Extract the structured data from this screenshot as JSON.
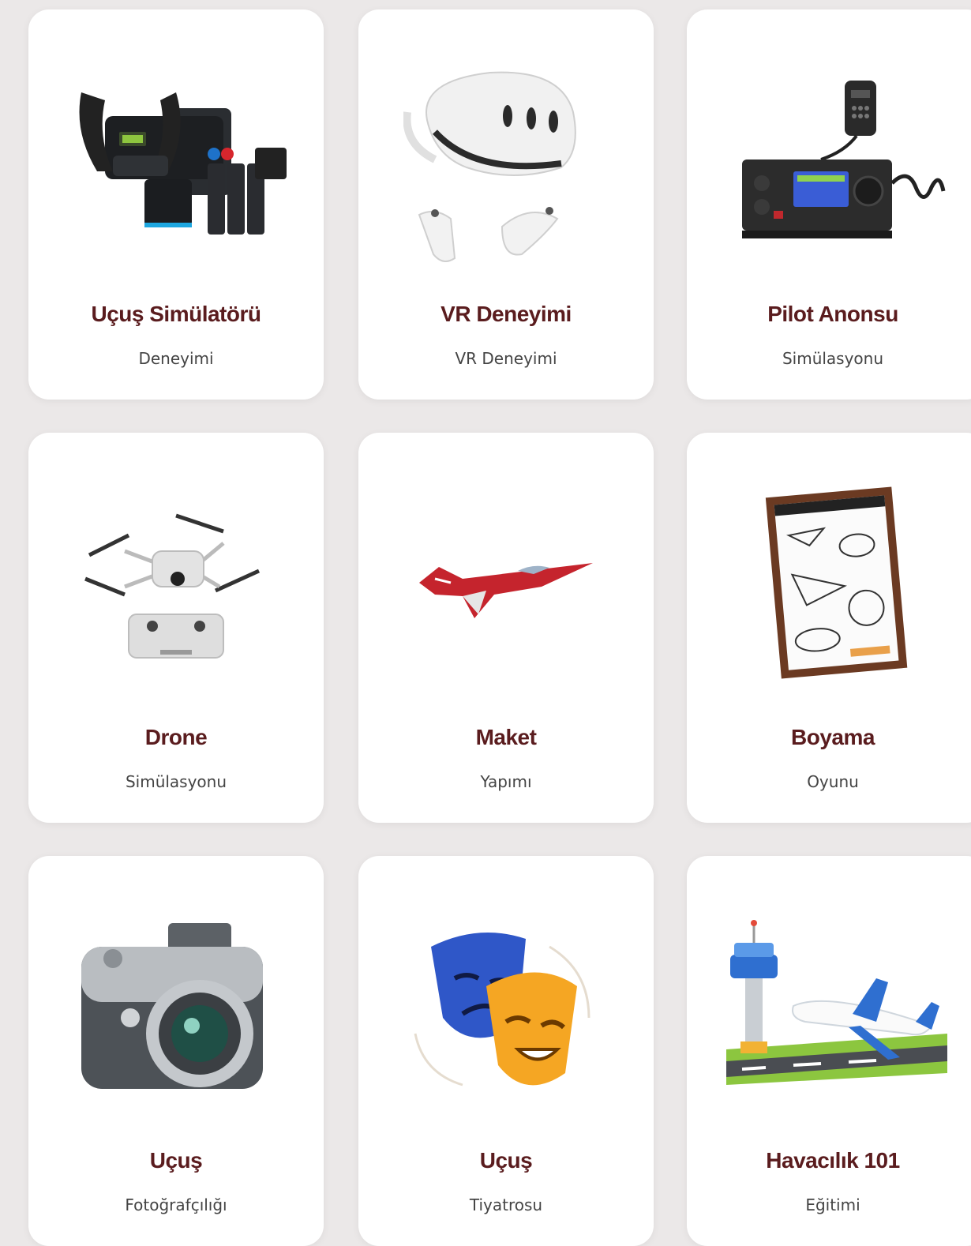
{
  "cards": [
    {
      "title": "Uçuş Simülatörü",
      "subtitle": "Deneyimi",
      "icon": "flight-simulator-yoke-icon"
    },
    {
      "title": "VR Deneyimi",
      "subtitle": "VR Deneyimi",
      "icon": "vr-headset-icon"
    },
    {
      "title": "Pilot Anonsu",
      "subtitle": "Simülasyonu",
      "icon": "radio-transceiver-icon"
    },
    {
      "title": "Drone",
      "subtitle": "Simülasyonu",
      "icon": "drone-icon"
    },
    {
      "title": "Maket",
      "subtitle": "Yapımı",
      "icon": "jet-model-icon"
    },
    {
      "title": "Boyama",
      "subtitle": "Oyunu",
      "icon": "coloring-board-icon"
    },
    {
      "title": "Uçuş",
      "subtitle": "Fotoğrafçılığı",
      "icon": "camera-icon"
    },
    {
      "title": "Uçuş",
      "subtitle": "Tiyatrosu",
      "icon": "theater-masks-icon"
    },
    {
      "title": "Havacılık 101",
      "subtitle": "Eğitimi",
      "icon": "airport-tower-airplane-icon"
    }
  ],
  "colors": {
    "background": "#ebe8e8",
    "card": "#ffffff",
    "title": "#5a1c1e",
    "subtitle": "#444444"
  }
}
